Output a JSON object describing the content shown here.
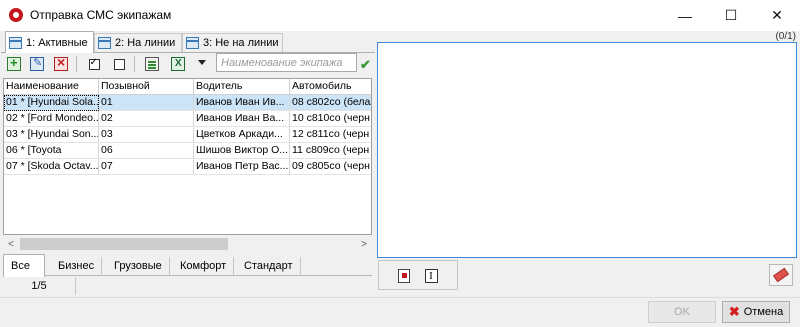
{
  "window": {
    "title": "Отправка СМС экипажам",
    "minimize": "—",
    "maximize": "☐",
    "close": "✕"
  },
  "tabs": [
    {
      "label": "1: Активные",
      "active": true
    },
    {
      "label": "2: На линии",
      "active": false
    },
    {
      "label": "3: Не на линии",
      "active": false
    }
  ],
  "search": {
    "placeholder": "Наименование экипажа",
    "go_icon": "✔"
  },
  "table": {
    "columns": [
      "Наименование",
      "Позывной",
      "Водитель",
      "Автомобиль"
    ],
    "rows": [
      {
        "name": "01 * [Hyundai Sola...",
        "callsign": "01",
        "driver": "Иванов Иван Ив...",
        "car": "08 с802со (белая",
        "selected": true
      },
      {
        "name": "02 * [Ford Mondeo...",
        "callsign": "02",
        "driver": "Иванов Иван Ва...",
        "car": "10 с810со (черн",
        "selected": false
      },
      {
        "name": "03 * [Hyundai Son...",
        "callsign": "03",
        "driver": "Цветков Аркади...",
        "car": "12 с811со (черн",
        "selected": false
      },
      {
        "name": "06 * [Toyota",
        "callsign": "06",
        "driver": "Шишов Виктор О...",
        "car": "11 с809со (черн",
        "selected": false
      },
      {
        "name": "07 * [Skoda Octav...",
        "callsign": "07",
        "driver": "Иванов Петр Вас...",
        "car": "09 с805со (черн",
        "selected": false
      }
    ]
  },
  "scroll": {
    "left": "<",
    "right": ">"
  },
  "categories": [
    "Все",
    "Бизнес",
    "Грузовые",
    "Комфорт",
    "Стандарт"
  ],
  "status": {
    "count": "1/5"
  },
  "message": {
    "counter": "(0/1)"
  },
  "buttons": {
    "ok": "OK",
    "cancel": "Отмена"
  }
}
